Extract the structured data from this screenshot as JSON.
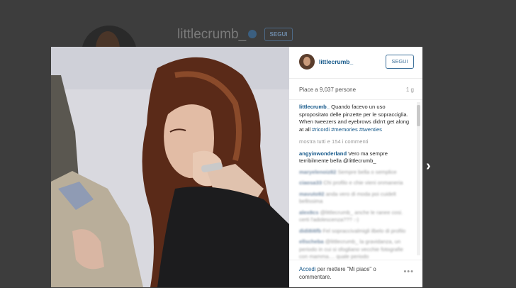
{
  "background": {
    "username": "littlecrumb_",
    "follow_label": "SEGUI"
  },
  "modal": {
    "username": "littlecrumb_",
    "follow_label": "SEGUI",
    "likes": "Piace a 9,037 persone",
    "time_ago": "1 g",
    "caption": {
      "author": "littlecrumb_",
      "text": "Quando facevo un uso spropositato delle pinzette per le sopracciglia. When tweezers and eyebrows didn't get along at all",
      "hashtags": [
        "#ricordi",
        "#memories",
        "#twenties"
      ]
    },
    "show_all_comments": "mostra tutti e 154 i commenti",
    "comments": [
      {
        "author": "angyinwonderland",
        "text": "Vero ma sempre terribilmente bella @littlecrumb_"
      },
      {
        "author": "maryelenoiz82",
        "text": "Sempre bella o semplice"
      },
      {
        "author": "ciaosa33",
        "text": "Chi profilo e chie vieni onmaneria"
      },
      {
        "author": "mavuto92",
        "text": "anda vero di moda poi cuidelt bellissima"
      },
      {
        "author": "alex8cs",
        "text": "@littlecrumb_ anche le ranee cosi. certi l'adolescenza??? :-)"
      },
      {
        "author": "didi8i6fb",
        "text": "Fel sopraccivalmigli ilbelo di profilo"
      },
      {
        "author": "ellscheba",
        "text": "@littlecrumb_ la gravidanza, un periodo in cui si sfogliano vecchie fotografie con mamma.... quale periodo"
      }
    ],
    "footer": {
      "login_link": "Accedi",
      "login_text": "per mettere \"Mi piace\" o commentare.",
      "more_icon": "ellipsis-icon"
    }
  },
  "navigation": {
    "next_icon": "chevron-right-icon"
  }
}
